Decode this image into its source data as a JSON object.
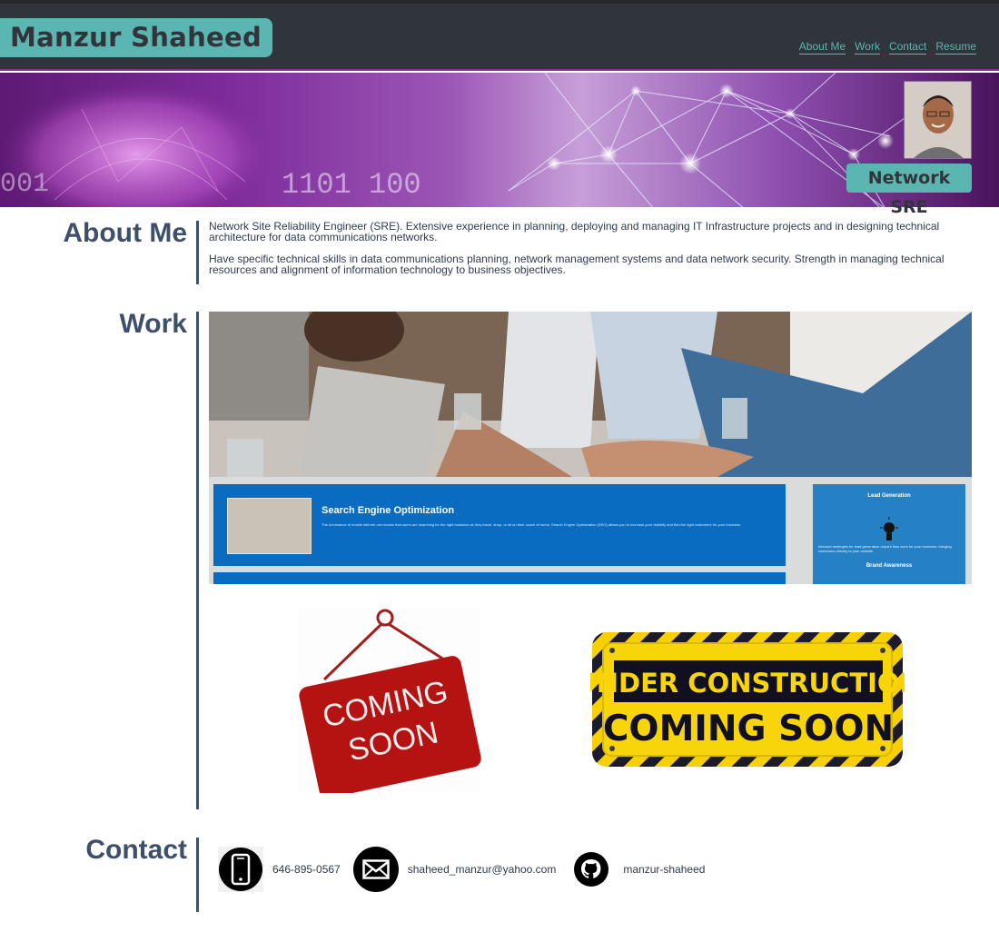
{
  "header": {
    "logo": "Manzur Shaheed",
    "nav": [
      "About Me",
      "Work",
      "Contact",
      "Resume"
    ]
  },
  "hero": {
    "binary_text": [
      "001",
      "1101 100"
    ],
    "badge": "Network SRE",
    "avatar_icon": "profile-photo"
  },
  "about": {
    "title": "About Me",
    "paragraphs": [
      "Network Site Reliability Engineer (SRE). Extensive experience in planning, deploying and managing IT Infrastructure projects and in designing technical architecture for data communications networks.",
      "Have specific technical skills in data communications planning, network management systems and data network security. Strength in managing technical resources and alignment of information technology to business objectives."
    ]
  },
  "work": {
    "title": "Work",
    "project": {
      "seo_title": "Search Engine Optimization",
      "seo_text": "The dominance of mobile internet use means that users are searching for the right business as they travel, shop, or sit on their couch at home. Search Engine Optimization (SEO) allows you to increase your visibility and find the right customers for your business.",
      "lead_title": "Lead Generation",
      "lead_text": "Inbound strategies for lead generation require less work for your business, bringing customers directly to your website.",
      "brand_title": "Brand Awareness"
    },
    "coming_soon_sign": [
      "COMING",
      "SOON"
    ],
    "construction_sign": [
      "UNDER CONSTRUCTION",
      "COMING SOON"
    ]
  },
  "contact": {
    "title": "Contact",
    "phone": "646-895-0567",
    "email": "shaheed_manzur@yahoo.com",
    "github": "manzur-shaheed"
  },
  "colors": {
    "teal": "#5bb5b1",
    "header_bg": "#30343b",
    "heading": "#3d4f6a"
  }
}
